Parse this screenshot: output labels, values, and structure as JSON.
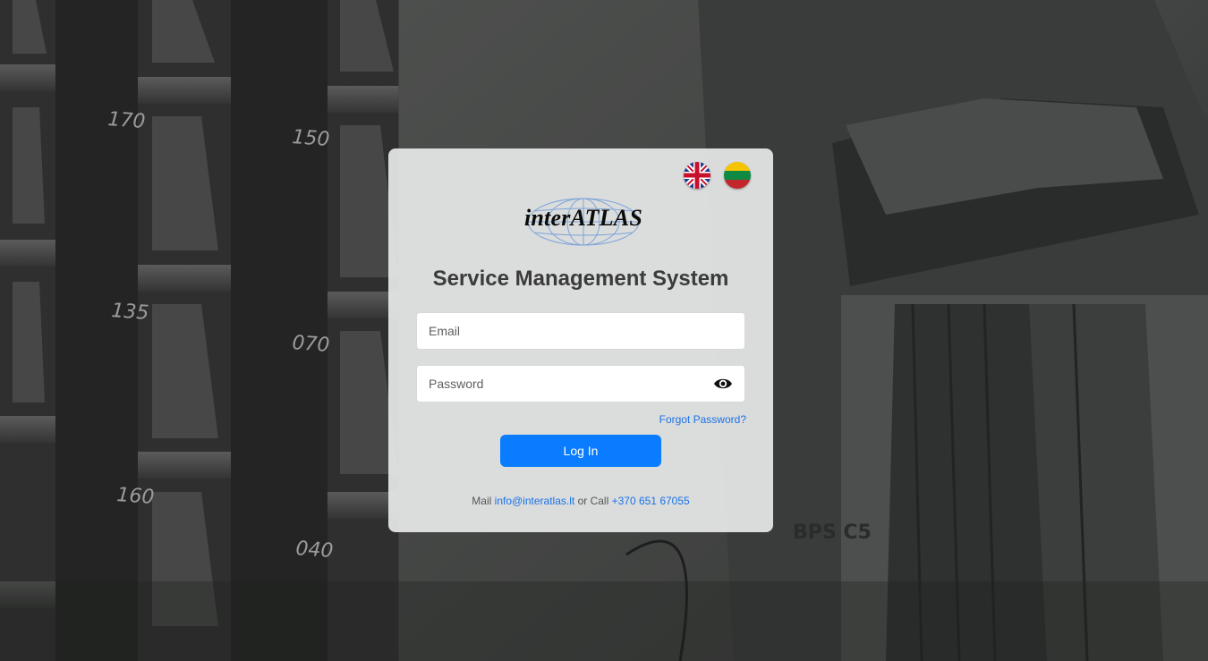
{
  "background": {
    "tray_labels": [
      "170",
      "150",
      "135",
      "070",
      "160",
      "040"
    ],
    "machine_label": "BPS C5"
  },
  "languages": [
    {
      "code": "en",
      "icon": "uk-flag-icon"
    },
    {
      "code": "lt",
      "icon": "lithuania-flag-icon"
    }
  ],
  "logo": {
    "text": "interATLAS"
  },
  "title": "Service Management System",
  "form": {
    "email_placeholder": "Email",
    "password_placeholder": "Password",
    "password_toggle_icon": "eye-icon",
    "forgot_password": "Forgot Password?",
    "login_label": "Log In"
  },
  "contact": {
    "mail_prefix": "Mail",
    "email": "info@interatlas.lt",
    "call_prefix": "or Call",
    "phone": "+370 651 67055"
  },
  "colors": {
    "accent": "#0a7cff",
    "link": "#1a73e8",
    "title": "#3b3b3b"
  }
}
